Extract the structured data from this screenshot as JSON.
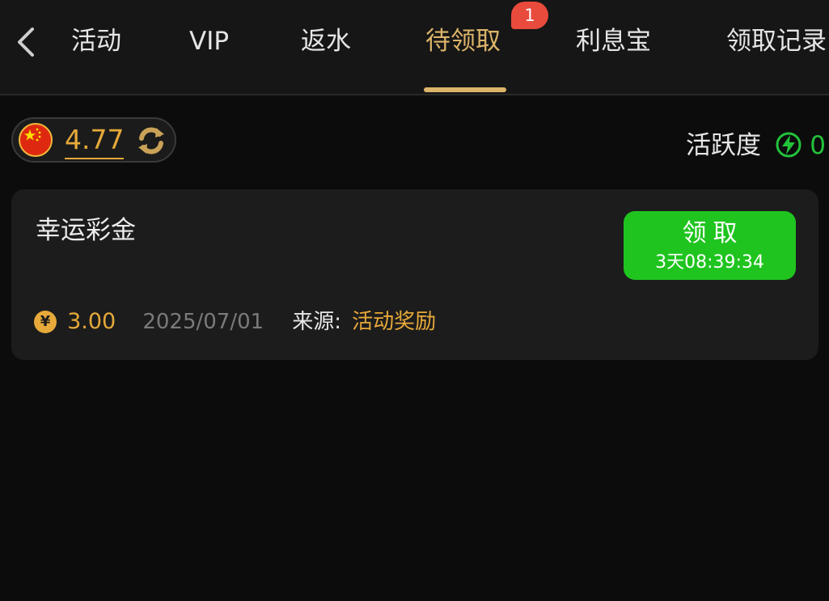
{
  "nav": {
    "tabs": [
      {
        "label": "活动",
        "active": false
      },
      {
        "label": "VIP",
        "active": false
      },
      {
        "label": "返水",
        "active": false
      },
      {
        "label": "待领取",
        "active": true
      },
      {
        "label": "利息宝",
        "active": false
      },
      {
        "label": "领取记录",
        "active": false
      }
    ],
    "badge_count": "1",
    "back_icon": "chevron-left-icon"
  },
  "balance": {
    "value": "4.77",
    "currency_flag": "china-flag-icon",
    "refresh_icon": "refresh-icon"
  },
  "activity": {
    "label": "活跃度",
    "value": "0",
    "icon": "lightning-icon"
  },
  "rewards": [
    {
      "title": "幸运彩金",
      "claim_label": "领取",
      "countdown": "3天08:39:34",
      "amount": "3.00",
      "date": "2025/07/01",
      "source_label": "来源:",
      "source_value": "活动奖励",
      "coin_icon": "yuan-coin-icon",
      "coin_symbol": "¥"
    }
  ],
  "colors": {
    "accent_gold": "#dcb469",
    "amount_orange": "#e6a93a",
    "claim_green": "#1fc41f",
    "activity_green": "#22c23a",
    "badge_red": "#e84a3c",
    "background": "#0c0c0c",
    "card_background": "#1c1c1c"
  }
}
